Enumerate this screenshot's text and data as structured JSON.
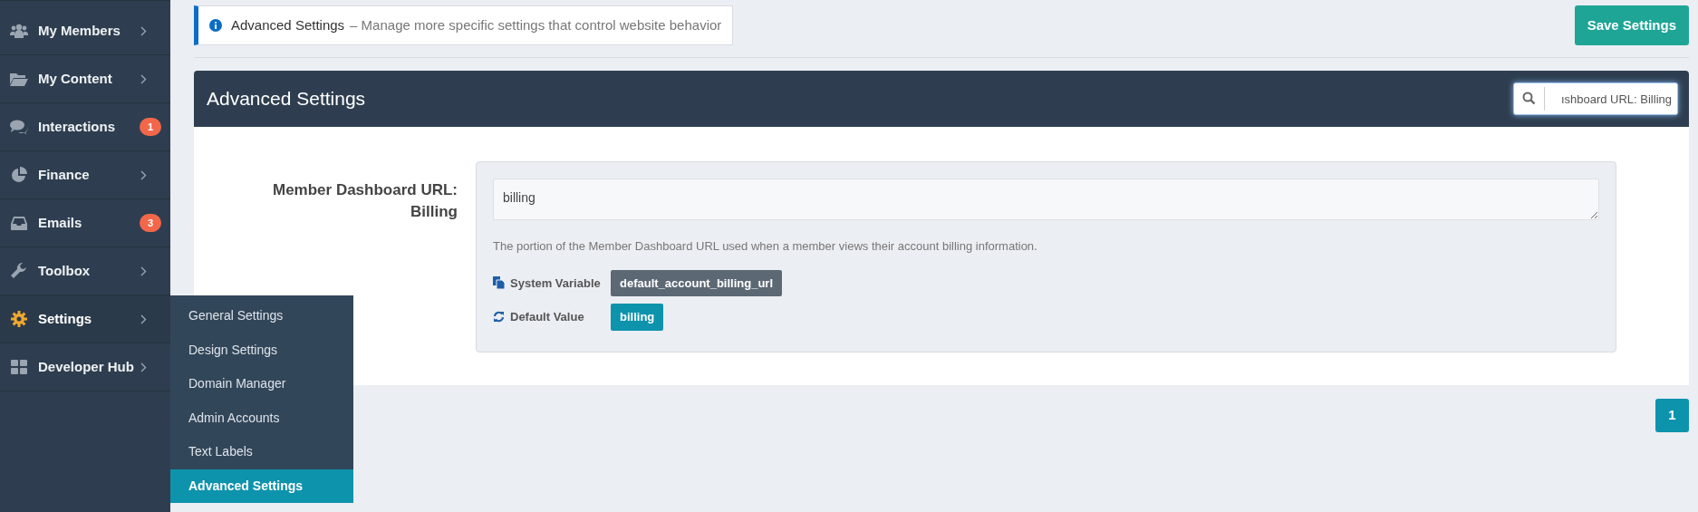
{
  "sidebar": {
    "items": [
      {
        "label": "My Members",
        "selected": false
      },
      {
        "label": "My Content",
        "selected": false
      },
      {
        "label": "Interactions",
        "badge": "1",
        "selected": false
      },
      {
        "label": "Finance",
        "selected": false
      },
      {
        "label": "Emails",
        "badge": "3",
        "selected": false
      },
      {
        "label": "Toolbox",
        "selected": false
      },
      {
        "label": "Settings",
        "selected": true
      },
      {
        "label": "Developer Hub",
        "selected": false
      }
    ]
  },
  "submenu": {
    "items": [
      {
        "label": "General Settings",
        "selected": false
      },
      {
        "label": "Design Settings",
        "selected": false
      },
      {
        "label": "Domain Manager",
        "selected": false
      },
      {
        "label": "Admin Accounts",
        "selected": false
      },
      {
        "label": "Text Labels",
        "selected": false
      },
      {
        "label": "Advanced Settings",
        "selected": true
      }
    ]
  },
  "banner": {
    "title": "Advanced Settings",
    "description": "– Manage more specific settings that control website behavior"
  },
  "save_button": "Save Settings",
  "panel": {
    "title": "Advanced Settings",
    "search": {
      "value": "ıshboard URL: Billing"
    }
  },
  "setting": {
    "label": "Member Dashboard URL: Billing",
    "value": "billing",
    "help": "The portion of the Member Dashboard URL used when a member views their account billing information.",
    "system_variable": {
      "label": "System Variable",
      "value": "default_account_billing_url"
    },
    "default_value": {
      "label": "Default Value",
      "value": "billing"
    }
  },
  "pagination": {
    "pages": [
      {
        "label": "1",
        "selected": true
      }
    ]
  }
}
